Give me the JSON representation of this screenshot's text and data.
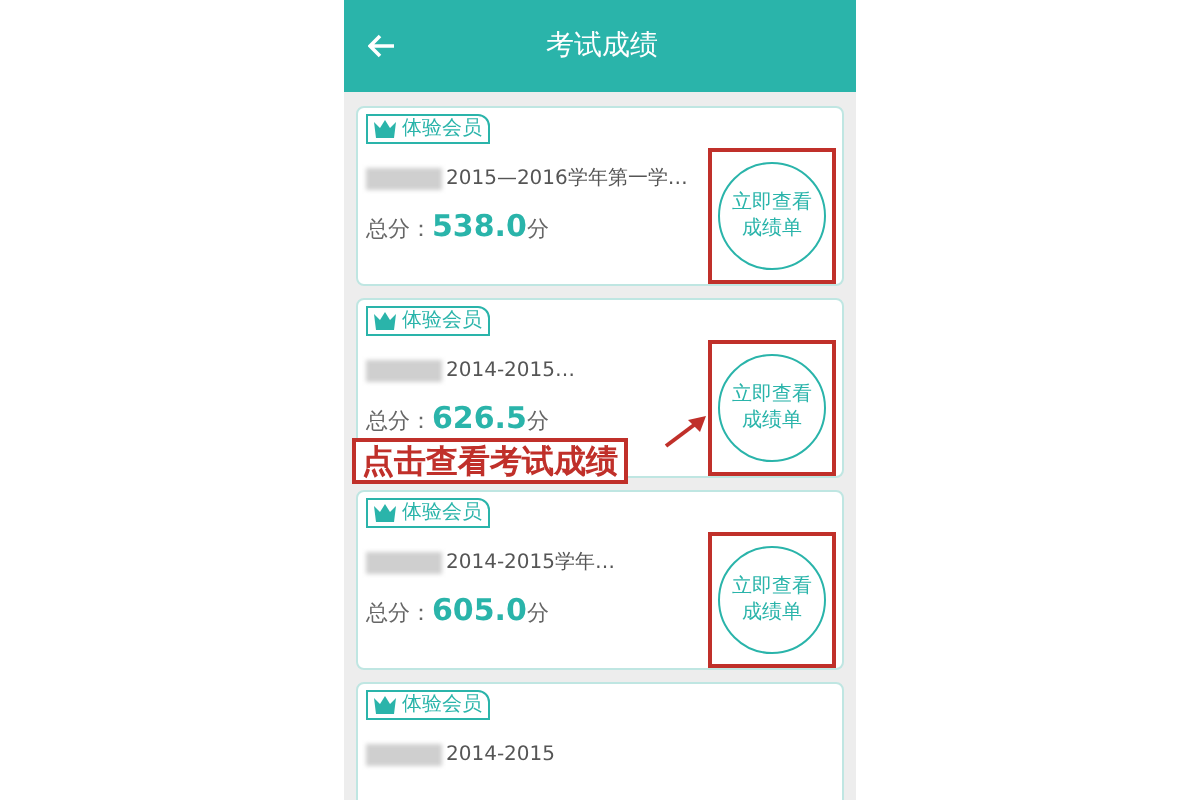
{
  "header": {
    "title": "考试成绩"
  },
  "cards": [
    {
      "badge": "体验会员",
      "title": "2015—2016学年第一学…",
      "score_label": "总分：",
      "score": "538.0",
      "score_unit": "分",
      "button": "立即查看成绩单",
      "highlighted": true
    },
    {
      "badge": "体验会员",
      "title": "2014-2015…",
      "score_label": "总分：",
      "score": "626.5",
      "score_unit": "分",
      "button": "立即查看成绩单",
      "highlighted": true
    },
    {
      "badge": "体验会员",
      "title": "2014-2015学年…",
      "score_label": "总分：",
      "score": "605.0",
      "score_unit": "分",
      "button": "立即查看成绩单",
      "highlighted": true
    },
    {
      "badge": "体验会员",
      "title": "2014-2015"
    }
  ],
  "callout": {
    "text": "点击查看考试成绩"
  }
}
